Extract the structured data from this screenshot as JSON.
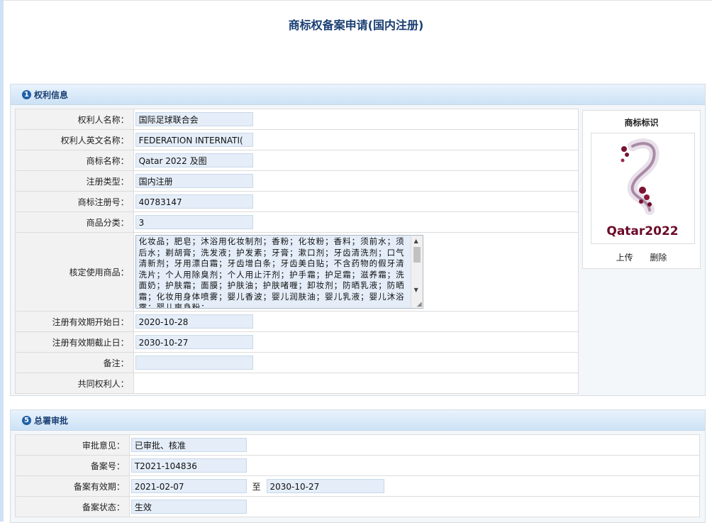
{
  "page": {
    "title": "商标权备案申请(国内注册)"
  },
  "section1": {
    "number": "1",
    "title": "权利信息",
    "rows": [
      {
        "label": "权利人名称：",
        "value": "国际足球联合会"
      },
      {
        "label": "权利人英文名称：",
        "value": "FEDERATION INTERNATI("
      },
      {
        "label": "商标名称：",
        "value": "Qatar 2022 及图"
      },
      {
        "label": "注册类型：",
        "value": "国内注册"
      },
      {
        "label": "商标注册号：",
        "value": "40783147"
      },
      {
        "label": "商品分类：",
        "value": "3"
      }
    ],
    "goods_label": "核定使用商品：",
    "goods_text": "化妆品；肥皂；沐浴用化妆制剂；香粉；化妆粉；香料；须前水；须后水；剃胡膏；洗发液；护发素；牙膏；漱口剂；牙齿清洗剂；口气清新剂；牙用漂白霜；牙齿增白条；牙齿美白贴；不含药物的假牙清洗片；个人用除臭剂；个人用止汗剂；护手霜；护足霜；滋养霜；洗面奶；护肤霜；面膜；护肤油；护肤啫喱；卸妆剂；防晒乳液；防晒霜；化妆用身体喷雾；婴儿香波；婴儿润肤油；婴儿乳液；婴儿沐浴露；婴儿爽身粉；",
    "rows2": [
      {
        "label": "注册有效期开始日：",
        "value": "2020-10-28"
      },
      {
        "label": "注册有效期截止日：",
        "value": "2030-10-27"
      },
      {
        "label": "备注：",
        "value": ""
      },
      {
        "label": "共同权利人：",
        "value": ""
      }
    ]
  },
  "logo_panel": {
    "title": "商标标识",
    "logo_text": "Qatar2022",
    "upload_label": "上传",
    "delete_label": "删除"
  },
  "section5": {
    "number": "5",
    "title": "总署审批",
    "rows": [
      {
        "label": "审批意见：",
        "value": "已审批、核准"
      },
      {
        "label": "备案号：",
        "value": "T2021-104836"
      }
    ],
    "validity": {
      "label": "备案有效期：",
      "from": "2021-02-07",
      "sep": "至",
      "to": "2030-10-27"
    },
    "status": {
      "label": "备案状态：",
      "value": "生效"
    }
  },
  "colors": {
    "accent": "#1a3f73",
    "field_bg": "#e4edf8",
    "header_grad_top": "#e9f3fc",
    "header_grad_bottom": "#cde2f6"
  }
}
